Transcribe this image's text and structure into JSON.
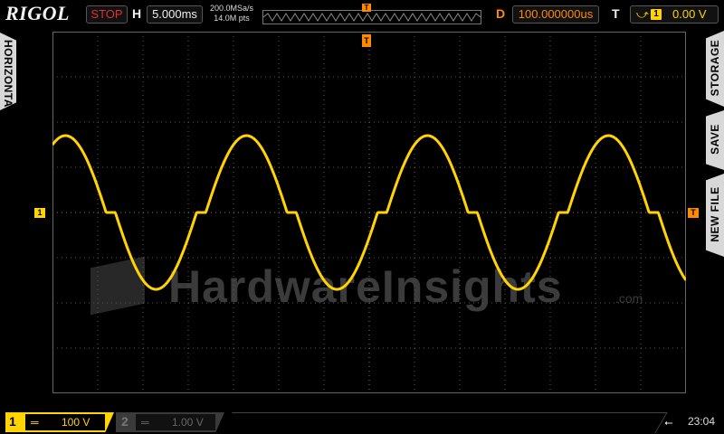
{
  "header": {
    "brand": "RIGOL",
    "run_state": "STOP",
    "timebase_label": "H",
    "timebase_value": "5.000ms",
    "sample_rate": "200.0MSa/s",
    "memory_depth": "14.0M pts",
    "trigger_marker": "T",
    "delay_label": "D",
    "delay_value": "100.000000us",
    "trigger_label": "T",
    "trigger_source": "1",
    "trigger_level": "0.00 V"
  },
  "side_menu": {
    "left_tab": "HORIZONTAL",
    "right_tabs": [
      "STORAGE",
      "SAVE",
      "NEW FILE"
    ]
  },
  "screen": {
    "ch1_marker": "1",
    "trigger_right_marker": "T",
    "trigger_top_marker": "T",
    "watermark": "HardwareInsights",
    "watermark_suffix": ".com",
    "waveform": {
      "type": "sine with crossover distortion",
      "periods_visible": 3.5,
      "color": "#ffd400"
    }
  },
  "footer": {
    "ch1": {
      "number": "1",
      "coupling": "═",
      "scale": "100 V",
      "color": "#ffd400"
    },
    "ch2": {
      "number": "2",
      "coupling": "═",
      "scale": "1.00 V",
      "color": "#666666"
    },
    "usb_icon": "⭠",
    "time": "23:04"
  }
}
